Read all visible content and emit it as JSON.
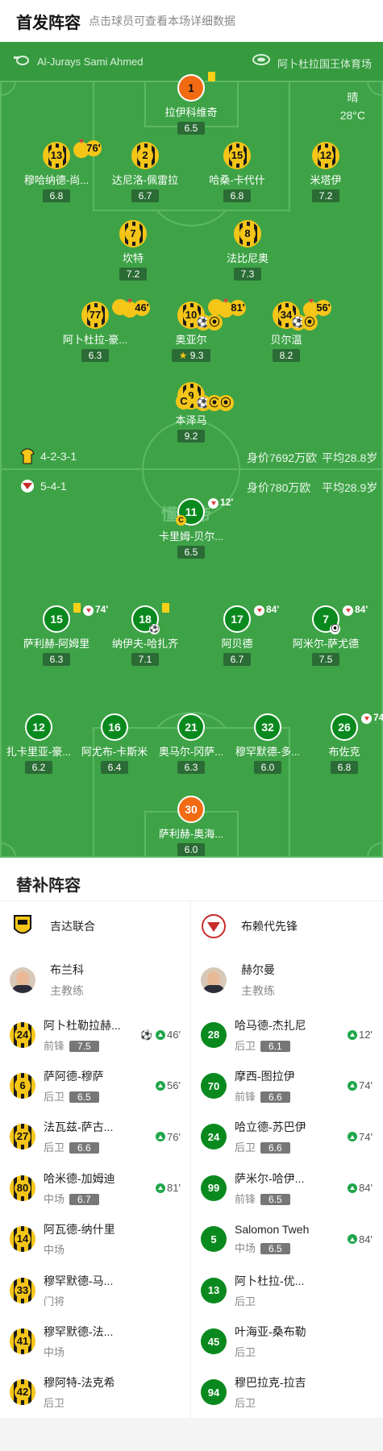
{
  "header": {
    "title": "首发阵容",
    "subtitle": "点击球员可查看本场详细数据"
  },
  "pitch_info": {
    "referee": "Al-Jurays Sami Ahmed",
    "venue": "阿卜杜拉国王体育场",
    "weather": "晴",
    "temperature": "28°C",
    "watermark": "懂球帝"
  },
  "home_team": {
    "formation": "4-2-3-1",
    "market_value": "身价7692万欧",
    "avg_age": "平均28.8岁",
    "kit_color": "#f5c518"
  },
  "away_team": {
    "formation": "5-4-1",
    "market_value": "身价780万欧",
    "avg_age": "平均28.9岁",
    "kit_color": "#0a8a1e"
  },
  "home_players": [
    {
      "number": "1",
      "name": "拉伊科维奇",
      "rating": "6.5",
      "kit": "gk-orange",
      "yellow": true
    },
    {
      "number": "13",
      "name": "穆哈纳德-尚...",
      "rating": "6.8",
      "kit": "yellow",
      "sub_out": "76'"
    },
    {
      "number": "2",
      "name": "达尼洛-佩雷拉",
      "rating": "6.7",
      "kit": "yellow"
    },
    {
      "number": "15",
      "name": "哈桑-卡代什",
      "rating": "6.8",
      "kit": "yellow"
    },
    {
      "number": "12",
      "name": "米塔伊",
      "rating": "7.2",
      "kit": "yellow"
    },
    {
      "number": "7",
      "name": "坎特",
      "rating": "7.2",
      "kit": "yellow"
    },
    {
      "number": "8",
      "name": "法比尼奥",
      "rating": "7.3",
      "kit": "yellow"
    },
    {
      "number": "77",
      "name": "阿卜杜拉-豪...",
      "rating": "6.3",
      "kit": "yellow",
      "yellow": true,
      "sub_out": "46'"
    },
    {
      "number": "10",
      "name": "奥亚尔",
      "rating": "9.3",
      "kit": "yellow",
      "yellow": true,
      "sub_out": "81'",
      "events": [
        "goal",
        "assist"
      ],
      "best": true
    },
    {
      "number": "34",
      "name": "贝尔温",
      "rating": "8.2",
      "kit": "yellow",
      "sub_out": "56'",
      "events": [
        "goal",
        "assist"
      ]
    },
    {
      "number": "9",
      "name": "本泽马",
      "rating": "9.2",
      "kit": "yellow",
      "captain": true,
      "events": [
        "goal",
        "assist",
        "assist"
      ]
    }
  ],
  "away_players": [
    {
      "number": "11",
      "name": "卡里姆-贝尔...",
      "rating": "6.5",
      "kit": "green",
      "captain": true,
      "sub_out": "12'"
    },
    {
      "number": "15",
      "name": "萨利赫-阿姆里",
      "rating": "6.3",
      "kit": "green",
      "yellow": true,
      "sub_out": "74'"
    },
    {
      "number": "18",
      "name": "纳伊夫-哈扎齐",
      "rating": "7.1",
      "kit": "green",
      "yellow": true,
      "events": [
        "goal"
      ]
    },
    {
      "number": "17",
      "name": "阿贝德",
      "rating": "6.7",
      "kit": "green",
      "sub_out": "84'"
    },
    {
      "number": "7",
      "name": "阿米尔-萨尤德",
      "rating": "7.5",
      "kit": "green",
      "sub_out": "84'",
      "events": [
        "assist"
      ]
    },
    {
      "number": "12",
      "name": "扎卡里亚-豪...",
      "rating": "6.2",
      "kit": "green"
    },
    {
      "number": "16",
      "name": "阿尤布-卡斯米",
      "rating": "6.4",
      "kit": "green"
    },
    {
      "number": "21",
      "name": "奥马尔-冈萨...",
      "rating": "6.3",
      "kit": "green"
    },
    {
      "number": "32",
      "name": "穆罕默德-多...",
      "rating": "6.0",
      "kit": "green"
    },
    {
      "number": "26",
      "name": "布佐克",
      "rating": "6.8",
      "kit": "green",
      "sub_out": "74'"
    },
    {
      "number": "30",
      "name": "萨利赫-奥海...",
      "rating": "6.0",
      "kit": "gk-orange2"
    }
  ],
  "subs": {
    "title": "替补阵容",
    "home": {
      "team_name": "吉达联合",
      "coach_name": "布兰科",
      "coach_role": "主教练",
      "players": [
        {
          "number": "24",
          "name": "阿卜杜勒拉赫...",
          "position": "前锋",
          "rating": "7.5",
          "sub_in": "46'",
          "goal": true
        },
        {
          "number": "6",
          "name": "萨阿德-穆萨",
          "position": "后卫",
          "rating": "6.5",
          "sub_in": "56'"
        },
        {
          "number": "27",
          "name": "法瓦兹-萨古...",
          "position": "后卫",
          "rating": "6.6",
          "sub_in": "76'"
        },
        {
          "number": "80",
          "name": "哈米德-加姆迪",
          "position": "中场",
          "rating": "6.7",
          "sub_in": "81'"
        },
        {
          "number": "14",
          "name": "阿瓦德-纳什里",
          "position": "中场",
          "rating": "",
          "sub_in": ""
        },
        {
          "number": "33",
          "name": "穆罕默德-马...",
          "position": "门将",
          "rating": "",
          "sub_in": ""
        },
        {
          "number": "41",
          "name": "穆罕默德-法...",
          "position": "中场",
          "rating": "",
          "sub_in": ""
        },
        {
          "number": "42",
          "name": "穆阿特-法克希",
          "position": "后卫",
          "rating": "",
          "sub_in": ""
        }
      ]
    },
    "away": {
      "team_name": "布赖代先锋",
      "coach_name": "赫尔曼",
      "coach_role": "主教练",
      "players": [
        {
          "number": "28",
          "name": "哈马德-杰扎尼",
          "position": "后卫",
          "rating": "6.1",
          "sub_in": "12'"
        },
        {
          "number": "70",
          "name": "摩西-图拉伊",
          "position": "前锋",
          "rating": "6.6",
          "sub_in": "74'"
        },
        {
          "number": "24",
          "name": "哈立德-苏巴伊",
          "position": "后卫",
          "rating": "6.6",
          "sub_in": "74'"
        },
        {
          "number": "99",
          "name": "萨米尔-哈伊...",
          "position": "前锋",
          "rating": "6.5",
          "sub_in": "84'"
        },
        {
          "number": "5",
          "name": "Salomon Tweh",
          "position": "中场",
          "rating": "6.5",
          "sub_in": "84'"
        },
        {
          "number": "13",
          "name": "阿卜杜拉-优...",
          "position": "后卫",
          "rating": "",
          "sub_in": ""
        },
        {
          "number": "45",
          "name": "叶海亚-桑布勒",
          "position": "后卫",
          "rating": "",
          "sub_in": ""
        },
        {
          "number": "94",
          "name": "穆巴拉克-拉吉",
          "position": "后卫",
          "rating": "",
          "sub_in": ""
        }
      ]
    }
  }
}
